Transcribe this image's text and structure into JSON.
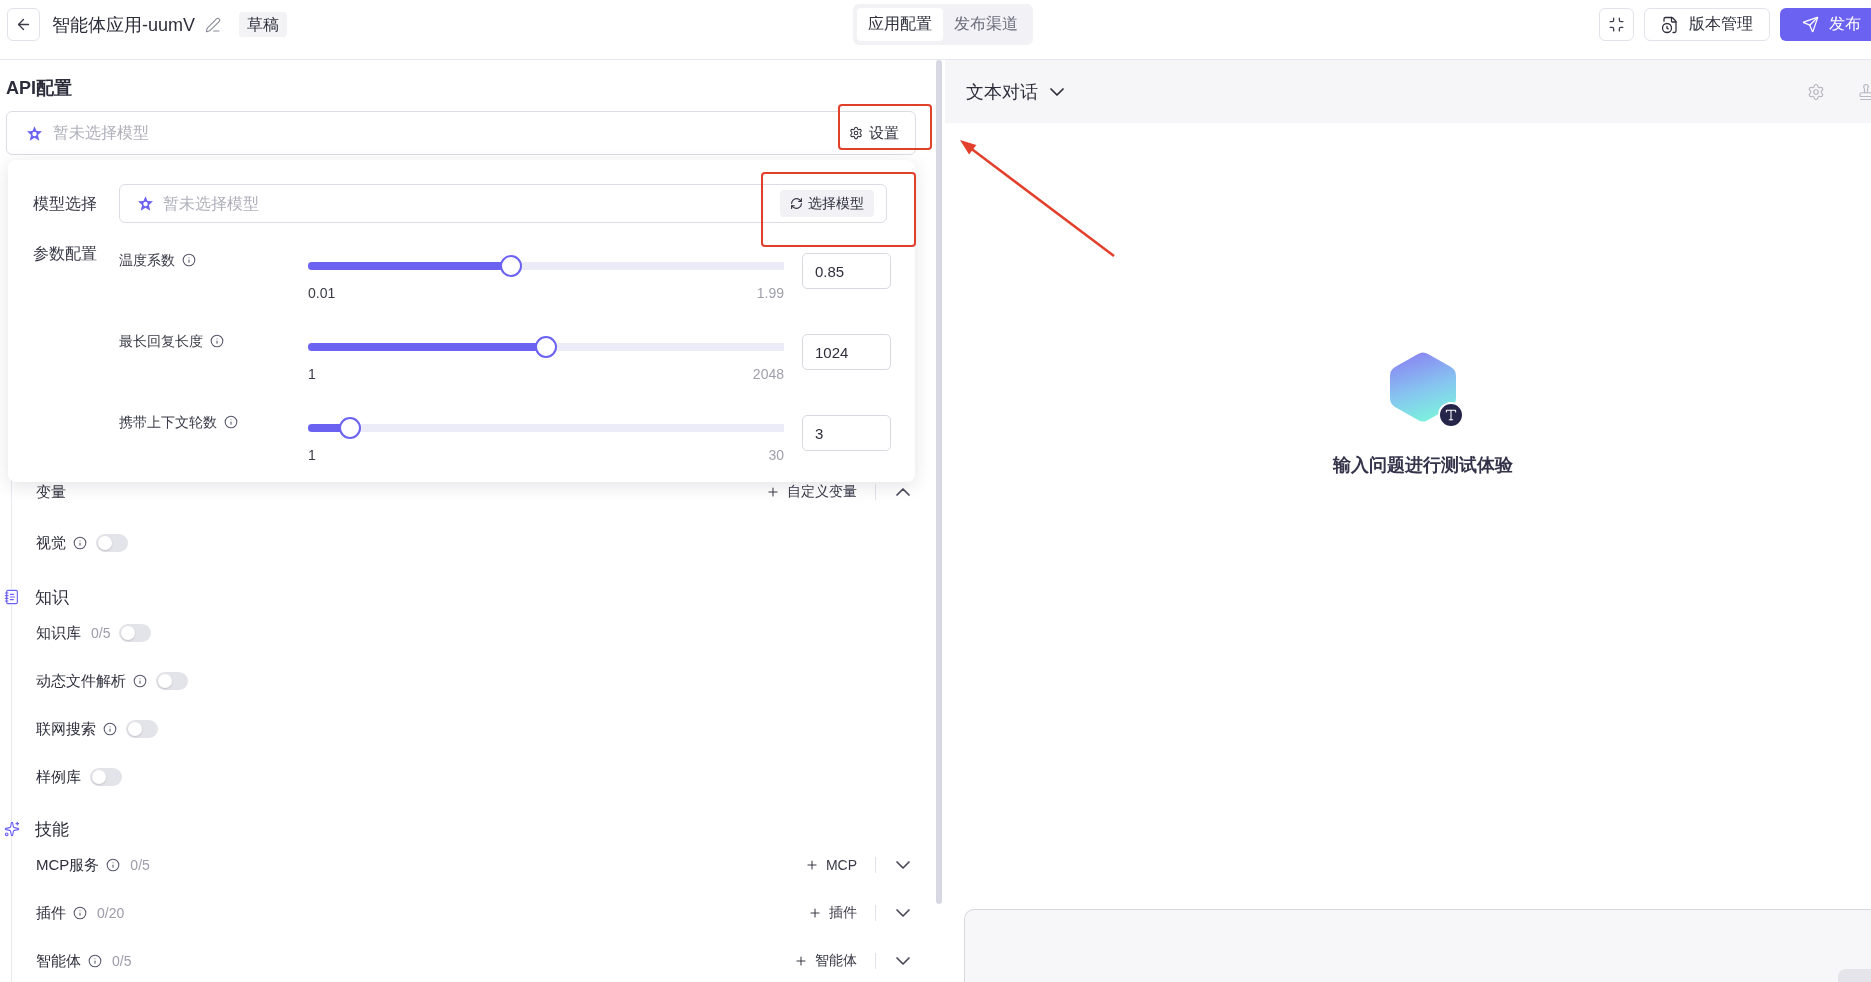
{
  "header": {
    "title": "智能体应用-uumV",
    "badge": "草稿",
    "tabs": [
      {
        "label": "应用配置",
        "selected": true
      },
      {
        "label": "发布渠道",
        "selected": false
      }
    ],
    "version_button": "版本管理",
    "publish_button": "发布"
  },
  "api_config": {
    "title": "API配置",
    "model_field": {
      "placeholder": "暂未选择模型"
    },
    "settings_button": "设置"
  },
  "model_popup": {
    "model_label": "模型选择",
    "model_field": {
      "placeholder": "暂未选择模型"
    },
    "select_button": "选择模型",
    "params_label": "参数配置",
    "params": [
      {
        "label": "温度系数",
        "info": true,
        "level": 0.424,
        "min": "0.01",
        "max": "1.99",
        "value": "0.85"
      },
      {
        "label": "最长回复长度",
        "info": true,
        "level": 0.5,
        "min": "1",
        "max": "2048",
        "value": "1024"
      },
      {
        "label": "携带上下文轮数",
        "info": true,
        "level": 0.069,
        "min": "1",
        "max": "30",
        "value": "3"
      }
    ]
  },
  "variables": {
    "title": "变量",
    "add_button": "自定义变量",
    "expanded": true
  },
  "vision": {
    "label": "视觉",
    "info": true,
    "on": false
  },
  "sections": [
    {
      "kind": "knowledge",
      "title": "知识",
      "items": [
        {
          "kind": "toggle",
          "label": "知识库",
          "info": false,
          "count": "0/5",
          "on": false
        },
        {
          "kind": "toggle",
          "label": "动态文件解析",
          "info": true,
          "on": false
        },
        {
          "kind": "toggle",
          "label": "联网搜索",
          "info": true,
          "on": false
        },
        {
          "kind": "toggle",
          "label": "样例库",
          "info": false,
          "on": false
        }
      ]
    },
    {
      "kind": "skills",
      "title": "技能",
      "items": [
        {
          "kind": "expandable",
          "label": "MCP服务",
          "info": true,
          "count": "0/5",
          "add_button": "MCP",
          "expanded": false
        },
        {
          "kind": "expandable",
          "label": "插件",
          "info": true,
          "count": "0/20",
          "add_button": "插件",
          "expanded": false
        },
        {
          "kind": "expandable",
          "label": "智能体",
          "info": true,
          "count": "0/5",
          "add_button": "智能体",
          "expanded": false
        }
      ]
    }
  ],
  "chat": {
    "mode": "文本对话",
    "empty_hint": "输入问题进行测试体验"
  }
}
